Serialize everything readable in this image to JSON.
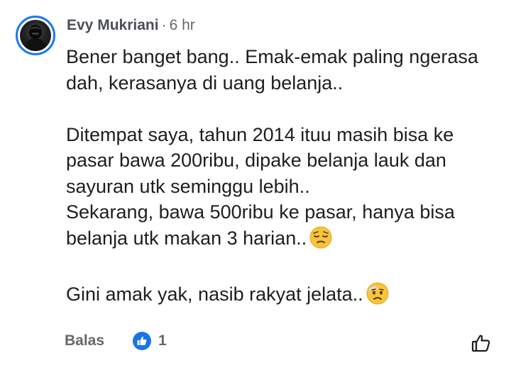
{
  "comment": {
    "author": "Evy Mukriani",
    "separator": "·",
    "time": "6 hr",
    "paragraphs": [
      "Bener banget bang.. Emak-emak paling ngerasa dah, kerasanya di uang belanja..",
      "Ditempat saya, tahun 2014 ituu masih bisa ke pasar bawa 200ribu, dipake belanja lauk dan sayuran utk seminggu lebih..",
      "Sekarang, bawa 500ribu ke pasar, hanya bisa belanja utk makan 3 harian..",
      "Gini amak yak, nasib rakyat jelata.."
    ],
    "emojis": [
      "pensive-face-emoji",
      "worried-face-emoji"
    ]
  },
  "actions": {
    "reply_label": "Balas",
    "reaction_icon": "like-icon",
    "reaction_count": "1",
    "like_button_icon": "thumbs-up-outline-icon"
  },
  "colors": {
    "accent": "#1877f2",
    "like_badge": "#1b74e4",
    "secondary_text": "#65676b",
    "primary_text": "#1c1e21"
  }
}
